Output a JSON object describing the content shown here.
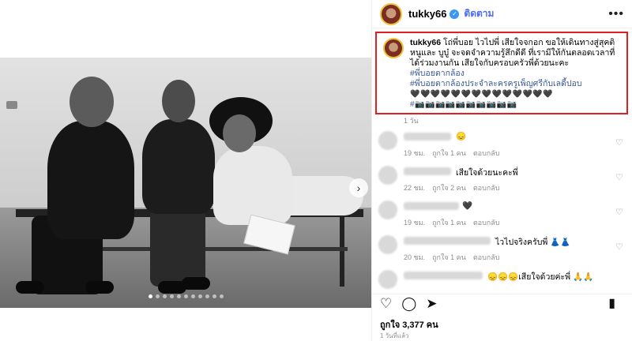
{
  "post": {
    "username": "tukky66",
    "follow_label": "ติดตาม",
    "more_label": "•••",
    "verified_icon": "✓"
  },
  "caption": {
    "username": "tukky66",
    "text": "โถ่พี่บอย ไวไปพี่ เสียใจจกอก ขอให้เดินทางสู่สุคติ หนูและ บูบู๋ จะจดจำความรู้สึกดีดี ที่เรามีให้กันตลอดเวลาที่ได้ร่วมงานกัน เสียใจกับครอบครัวพี่ด้วยนะคะ",
    "tag1": "#พี่บอยตากล้อง",
    "tag2": "#พี่บอยตากล้องประจำละครครูเพ็ญศรีกับเลดี้ปอบ",
    "emoji_hearts": "🖤🖤🖤🖤🖤🖤🖤🖤🖤🖤🖤🖤🖤🖤",
    "emoji_cameras": "#📷📷📷📷📷📷📷📷📷📷",
    "time": "1 วัน"
  },
  "comments": [
    {
      "text": "😞",
      "time": "19 ชม.",
      "likes": "ถูกใจ 1 คน",
      "reply": "ตอบกลับ"
    },
    {
      "text": "เสียใจด้วยนะคะพี่",
      "time": "22 ชม.",
      "likes": "ถูกใจ 2 คน",
      "reply": "ตอบกลับ"
    },
    {
      "text": "🖤",
      "time": "19 ชม.",
      "likes": "ถูกใจ 1 คน",
      "reply": "ตอบกลับ"
    },
    {
      "text": "ไวไปจริงครับพี่ 👗👗",
      "time": "20 ชม.",
      "likes": "ถูกใจ 1 คน",
      "reply": "ตอบกลับ"
    },
    {
      "text": "😞😞😞เสียใจด้วยค่ะพี่ 🙏🙏",
      "time": "",
      "likes": "",
      "reply": ""
    }
  ],
  "actions": {
    "like_icon": "heart-icon",
    "comment_icon": "comment-icon",
    "share_icon": "share-icon",
    "save_icon": "bookmark-icon"
  },
  "likes_text": "ถูกใจ 3,377 คน",
  "posted_text": "1 วันที่แล้ว",
  "colors": {
    "highlight_border": "#e02020",
    "link": "#4a6cf7",
    "verified": "#3897f0"
  }
}
